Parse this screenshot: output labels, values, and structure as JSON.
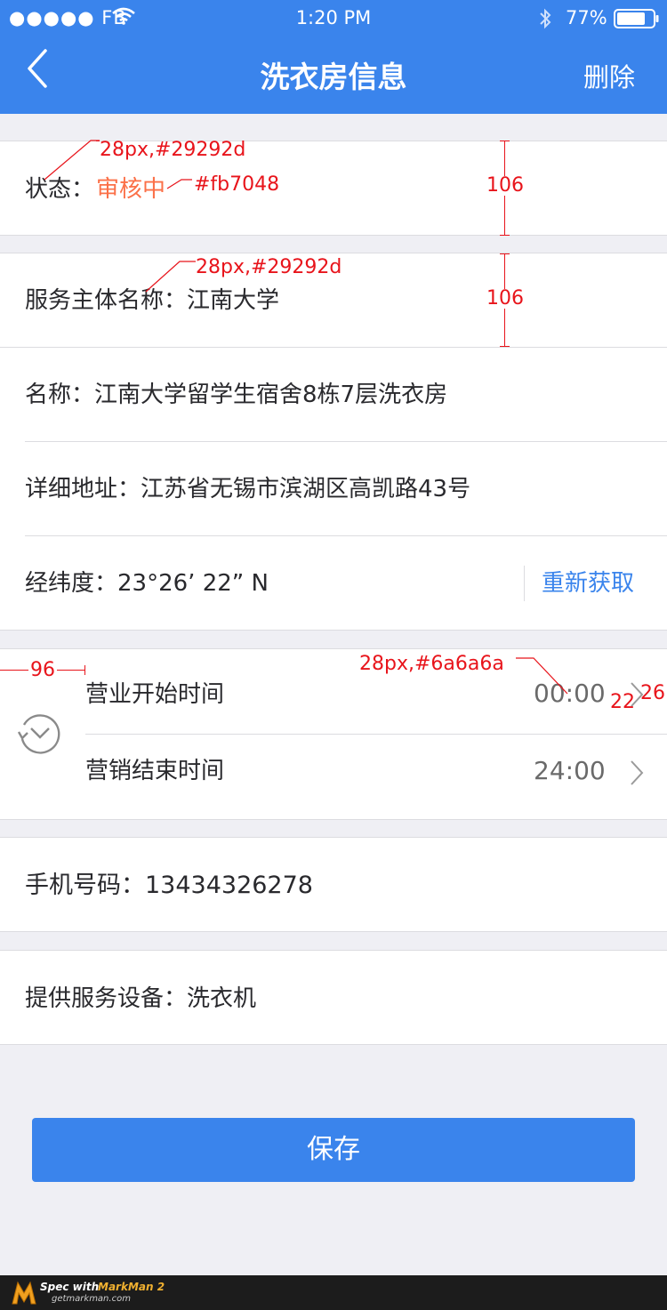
{
  "status_bar": {
    "carrier": "●●●●● FB",
    "time": "1:20 PM",
    "battery": "77%"
  },
  "nav": {
    "title": "洗衣房信息",
    "delete_label": "删除"
  },
  "status": {
    "label": "状态：",
    "value": "审核中",
    "value_color": "#fb7048"
  },
  "fields": {
    "service_entity": "服务主体名称：江南大学",
    "name": "名称：江南大学留学生宿舍8栋7层洗衣房",
    "address": "详细地址：江苏省无锡市滨湖区高凯路43号",
    "coords": "经纬度：23°26’ 22” N",
    "refresh_label": "重新获取",
    "phone": "手机号码：13434326278",
    "equipment": "提供服务设备：洗衣机"
  },
  "hours": {
    "start_label": "营业开始时间",
    "start_value": "00:00",
    "end_label": "营销结束时间",
    "end_value": "24:00"
  },
  "save_label": "保存",
  "annotations": {
    "a1": "28px,#29292d",
    "a2": "#fb7048",
    "a3": "106",
    "a4": "28px,#29292d",
    "a5": "106",
    "a6": "96",
    "a7": "28px,#6a6a6a",
    "a8": "22",
    "a9": "26"
  },
  "watermark": {
    "spec_with": "Spec with",
    "product": "MarkMan 2",
    "site": "getmarkman.com"
  },
  "colors": {
    "header": "#3a84ec",
    "text": "#29292d",
    "secondary_text": "#6a6a6a",
    "accent_orange": "#fb7048",
    "annotation": "#e8141b"
  }
}
